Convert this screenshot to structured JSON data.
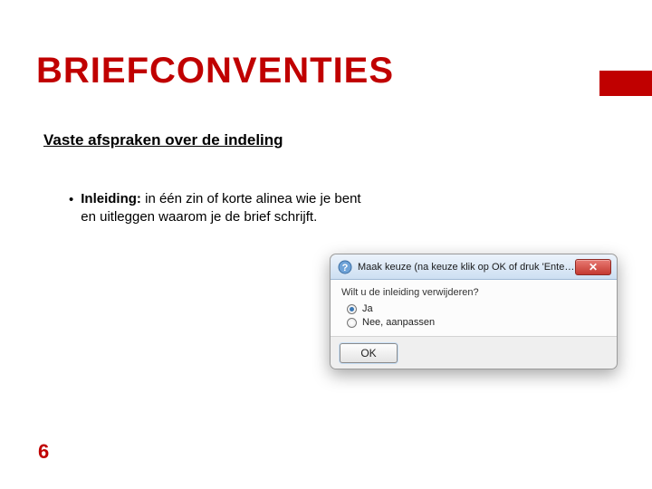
{
  "slide": {
    "title": "BRIEFCONVENTIES",
    "subtitle": "Vaste afspraken over de indeling",
    "bullet": {
      "label": "Inleiding:",
      "body": " in één zin of korte alinea wie je bent en uitleggen waarom je de brief schrijft."
    },
    "page_number": "6"
  },
  "dialog": {
    "title": "Maak keuze  (na keuze klik op OK of druk 'Enter'-toets)",
    "question": "Wilt u de inleiding verwijderen?",
    "options": {
      "yes": "Ja",
      "no": "Nee, aanpassen"
    },
    "ok_label": "OK",
    "close_glyph": "✕"
  }
}
